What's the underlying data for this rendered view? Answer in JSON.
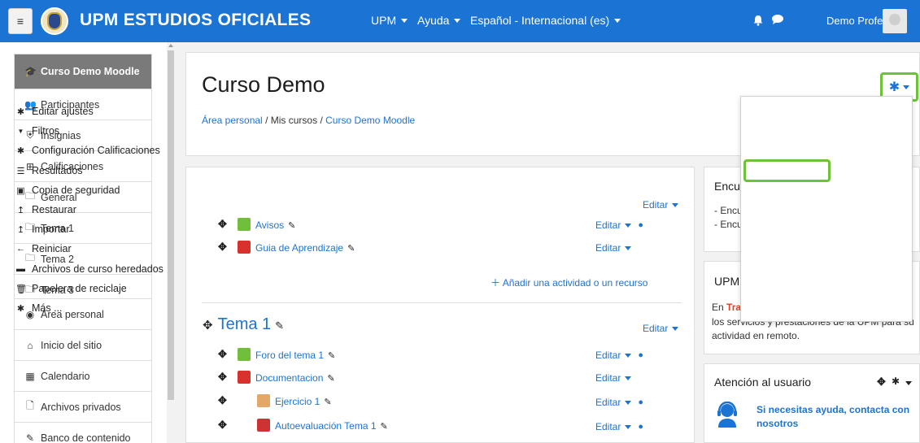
{
  "navbar": {
    "menu_glyph": "≡",
    "site_title": "UPM ESTUDIOS OFICIALES",
    "menus": [
      "UPM",
      "Ayuda",
      "Español - Internacional (es)"
    ],
    "user_name": "Demo Profesor"
  },
  "drawer": {
    "course_items": [
      {
        "label": "Curso Demo Moodle",
        "icon": "graduation-cap-icon",
        "glyph": "🎓"
      },
      {
        "label": "Participantes",
        "icon": "users-icon",
        "glyph": "👥"
      },
      {
        "label": "Insignias",
        "icon": "shield-icon",
        "glyph": "⛨"
      },
      {
        "label": "Calificaciones",
        "icon": "table-icon",
        "glyph": "⊞"
      },
      {
        "label": "General",
        "icon": "folder-icon",
        "glyph": "🗀"
      },
      {
        "label": "Tema 1",
        "icon": "folder-icon",
        "glyph": "🗀"
      },
      {
        "label": "Tema 2",
        "icon": "folder-icon",
        "glyph": "🗀"
      },
      {
        "label": "Tema 3",
        "icon": "folder-icon",
        "glyph": "🗀"
      }
    ],
    "site_items": [
      {
        "label": "Área personal",
        "icon": "dashboard-icon",
        "glyph": "◉"
      },
      {
        "label": "Inicio del sitio",
        "icon": "home-icon",
        "glyph": "⌂"
      },
      {
        "label": "Calendario",
        "icon": "calendar-icon",
        "glyph": "▦"
      },
      {
        "label": "Archivos privados",
        "icon": "file-icon",
        "glyph": "🗋"
      },
      {
        "label": "Banco de contenido",
        "icon": "pen-icon",
        "glyph": "✎"
      }
    ]
  },
  "header": {
    "title": "Curso Demo",
    "breadcrumb": [
      "Área personal",
      "/",
      "Mis cursos",
      "/",
      "Curso Demo Moodle"
    ]
  },
  "course": {
    "editar_label": "Editar",
    "general_activities": [
      {
        "name": "Avisos",
        "icon": "forum-icon"
      },
      {
        "name": "Guia de Aprendizaje",
        "icon": "pdf-icon"
      }
    ],
    "add_activity": "Añadir una actividad o un recurso",
    "section_title": "Tema 1",
    "tema1_activities": [
      {
        "name": "Foro del tema 1",
        "icon": "forum-icon"
      },
      {
        "name": "Documentacion",
        "icon": "pdf-icon"
      },
      {
        "name": "Ejercicio 1",
        "icon": "assignment-icon"
      },
      {
        "name": "Autoevaluación Tema 1",
        "icon": "quiz-icon"
      }
    ]
  },
  "blocks": {
    "encuestas_title": "Encu",
    "encuestas_lines": [
      "- Encu",
      "- Encu"
    ],
    "upm_title": "UPM",
    "upm_text_highlight": "Tra",
    "upm_text_prefix": "En",
    "upm_text_line2": "los servicios y prestaciones de la UPM para su",
    "upm_text_line3": "actividad en remoto.",
    "atencion_title": "Atención al usuario",
    "atencion_text": "Si necesitas ayuda, contacta con nosotros"
  },
  "dropdown": {
    "items": [
      {
        "label": "Editar ajustes",
        "icon": "gear-icon",
        "glyph": "✱"
      },
      {
        "label": "Filtros",
        "icon": "filter-icon",
        "glyph": "▼"
      },
      {
        "label": "Configuración Calificaciones",
        "icon": "gear-icon",
        "glyph": "✱"
      },
      {
        "label": "Resultados",
        "icon": "list-icon",
        "glyph": "☰"
      },
      {
        "label": "Copia de seguridad",
        "icon": "archive-icon",
        "glyph": "▣"
      },
      {
        "label": "Restaurar",
        "icon": "upload-icon",
        "glyph": "↥"
      },
      {
        "label": "Importar",
        "icon": "import-icon",
        "glyph": "↥"
      },
      {
        "label": "Reiniciar",
        "icon": "arrow-left-icon",
        "glyph": "←"
      },
      {
        "label": "Archivos de curso heredados",
        "icon": "folder-icon",
        "glyph": "▬"
      },
      {
        "label": "Papelera de reciclaje",
        "icon": "trash-icon",
        "glyph": "🗑"
      },
      {
        "label": "Más ...",
        "icon": "gear-icon",
        "glyph": "✱"
      }
    ]
  },
  "colors": {
    "brand_blue": "#1b73d4",
    "highlight_green": "#6cc33b",
    "active_gray": "#7a7a7a"
  }
}
